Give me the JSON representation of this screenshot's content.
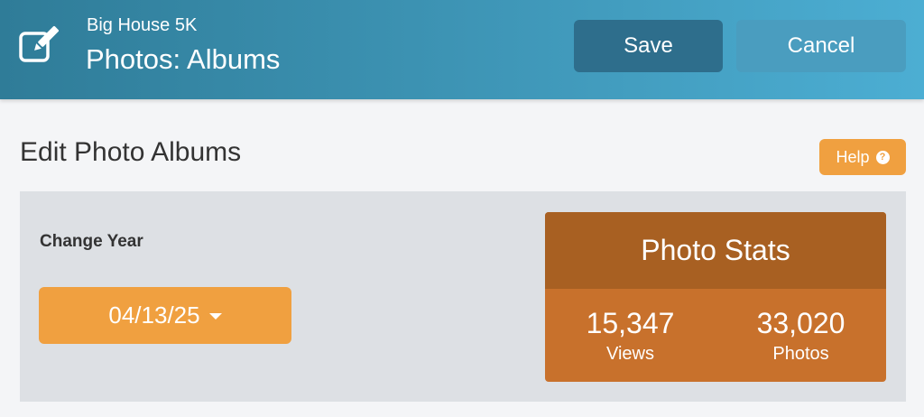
{
  "header": {
    "subtitle": "Big House 5K",
    "title": "Photos: Albums",
    "save_label": "Save",
    "cancel_label": "Cancel",
    "icon": "edit-icon"
  },
  "main": {
    "heading": "Edit Photo Albums",
    "help_label": "Help",
    "help_icon": "question-circle-icon",
    "change_year_label": "Change Year",
    "year_value": "04/13/25"
  },
  "stats": {
    "title": "Photo Stats",
    "views_value": "15,347",
    "views_label": "Views",
    "photos_value": "33,020",
    "photos_label": "Photos"
  },
  "colors": {
    "header_start": "#2f7c98",
    "header_end": "#4caed3",
    "save_button": "#2e6e8c",
    "cancel_button": "#4a9dbf",
    "accent_orange": "#f0a040",
    "stats_header": "#a86022",
    "stats_body": "#c8712c",
    "panel_bg": "#dde0e4"
  }
}
